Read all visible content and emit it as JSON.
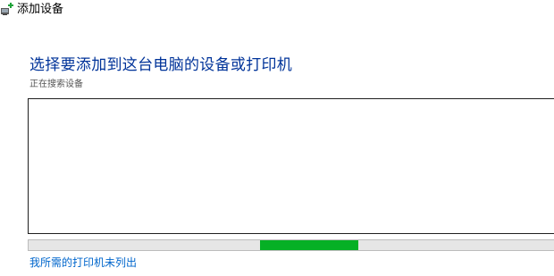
{
  "window": {
    "title": "添加设备",
    "icon": "add-device-icon"
  },
  "main": {
    "heading": "选择要添加到这台电脑的设备或打印机",
    "status_text": "正在搜索设备",
    "device_list": {
      "items": []
    },
    "progress": {
      "mode": "indeterminate",
      "color": "#06b025",
      "track_color": "#e6e6e6",
      "chunk_start_fraction": 0.436,
      "chunk_width_fraction": 0.185
    },
    "printer_not_listed_link": "我所需的打印机未列出"
  },
  "colors": {
    "heading": "#003399",
    "link": "#0066cc",
    "status": "#555555"
  }
}
